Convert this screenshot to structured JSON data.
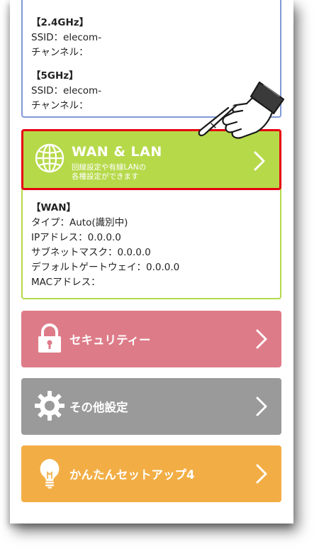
{
  "wireless": {
    "band1_head": "【2.4GHz】",
    "band1_ssid": "SSID：elecom-",
    "band1_channel": "チャンネル：",
    "band2_head": "【5GHz】",
    "band2_ssid": "SSID：elecom-",
    "band2_channel": "チャンネル："
  },
  "wan_lan_button": {
    "title": "WAN & LAN",
    "subtitle_line1": "回線設定や有線LANの",
    "subtitle_line2": "各種設定ができます",
    "icon": "globe-icon",
    "highlight_color": "#e60012"
  },
  "wan_info": {
    "head": "【WAN】",
    "type": "タイプ：Auto(識別中)",
    "ip": "IPアドレス：0.0.0.0",
    "subnet": "サブネットマスク：0.0.0.0",
    "gateway": "デフォルトゲートウェイ：0.0.0.0",
    "mac": "MACアドレス："
  },
  "menu": {
    "security_label": "セキュリティー",
    "security_icon": "lock-icon",
    "other_label": "その他設定",
    "other_icon": "gear-icon",
    "easy_label": "かんたんセットアップ4",
    "easy_icon": "lightbulb-icon"
  },
  "colors": {
    "wan_lan": "#b6d94a",
    "security": "#de7b88",
    "other": "#9a9a9a",
    "easy": "#f2ae45",
    "wireless_border": "#7f99d6"
  },
  "pointer": "pointing-hand-icon"
}
